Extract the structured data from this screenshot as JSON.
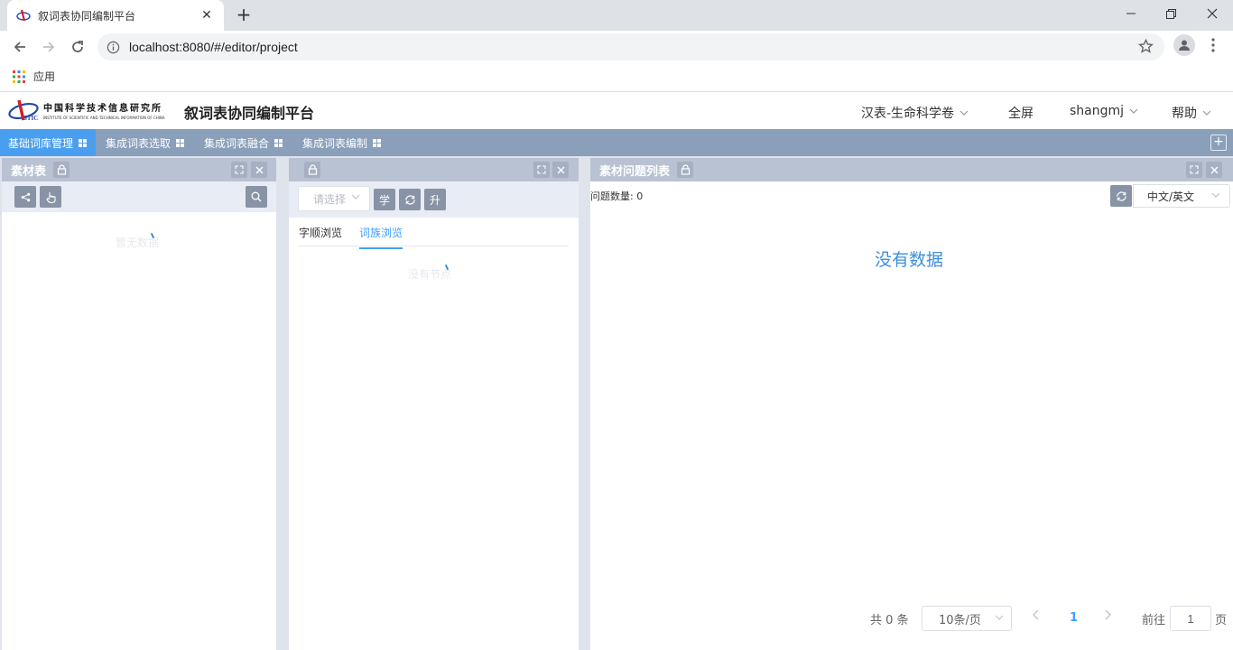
{
  "browser": {
    "tab_title": "叙词表协同编制平台",
    "url": "localhost:8080/#/editor/project",
    "bookmark_apps": "应用"
  },
  "header": {
    "logo_cn": "中国科学技术信息研究所",
    "logo_en": "INSTITUTE OF SCIENTIFIC AND TECHNICAL INFORMATION OF CHINA",
    "title": "叙词表协同编制平台",
    "volume": "汉表-生命科学卷",
    "fullscreen": "全屏",
    "user": "shangmj",
    "help": "帮助"
  },
  "nav": {
    "tabs": [
      "基础词库管理",
      "集成词表选取",
      "集成词表融合",
      "集成词表编制"
    ],
    "active_index": 0
  },
  "left_panel": {
    "title": "素材表",
    "empty_text": "暂无数据"
  },
  "middle_panel": {
    "select_placeholder": "请选择",
    "btn_xue": "学",
    "btn_sheng": "升",
    "subtabs": [
      "字顺浏览",
      "词族浏览"
    ],
    "active_subtab": 1,
    "empty_text": "没有节点"
  },
  "right_panel": {
    "title": "素材问题列表",
    "count_label": "问题数量: 0",
    "lang": "中文/英文",
    "nodata": "没有数据",
    "pager": {
      "total": "共 0 条",
      "page_size": "10条/页",
      "current_page": "1",
      "goto_label": "前往",
      "goto_value": "1",
      "page_suffix": "页"
    }
  },
  "colors": {
    "nav_bg": "#8a9fba",
    "nav_active": "#4a9ef0",
    "panel_head": "#b9c2d2",
    "accent": "#409eff"
  }
}
